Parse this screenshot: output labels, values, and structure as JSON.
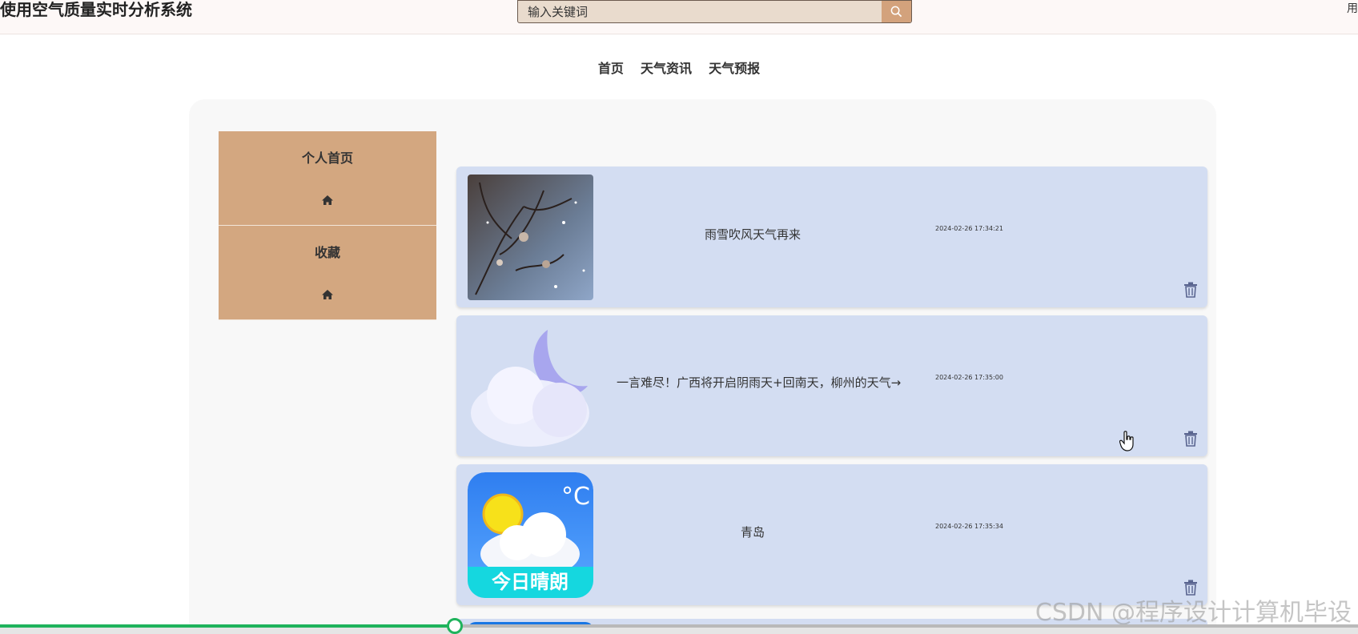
{
  "header": {
    "site_title": "使用空气质量实时分析系统",
    "search_placeholder": "输入关键词",
    "user_fragment": "用"
  },
  "nav": {
    "items": [
      "首页",
      "天气资讯",
      "天气预报"
    ]
  },
  "sidebar": {
    "items": [
      {
        "label": "个人首页"
      },
      {
        "label": "收藏"
      }
    ]
  },
  "cards": [
    {
      "title": "雨雪吹风天气再来",
      "time": "2024-02-26 17:34:21"
    },
    {
      "title": "一言难尽！广西将开启阴雨天+回南天，柳州的天气→",
      "time": "2024-02-26 17:35:00"
    },
    {
      "title": "青岛",
      "time": "2024-02-26 17:35:34",
      "thumb_text": "今日晴朗",
      "thumb_unit": "°C"
    }
  ],
  "player": {
    "progress": 0.335
  },
  "watermark": "CSDN @程序设计计算机毕设",
  "colors": {
    "accent": "#d3a780",
    "card": "#d3ddf2",
    "progress": "#1fb35c"
  }
}
